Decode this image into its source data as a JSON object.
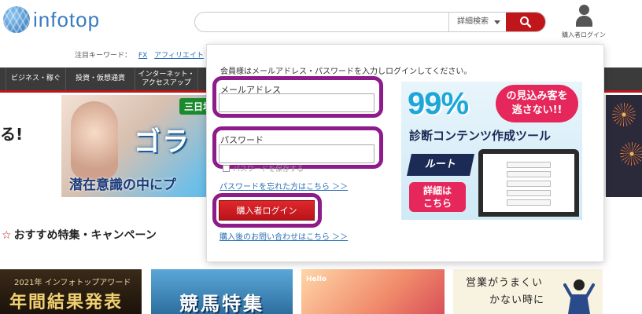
{
  "header": {
    "logo_text": "infotop",
    "search_placeholder": "",
    "search_detail_label": "詳細検索",
    "user_label": "購入者ログイン"
  },
  "keywords": {
    "label": "注目キーワード：",
    "items": [
      "FX",
      "アフィリエイト"
    ]
  },
  "nav": {
    "items": [
      "ビジネス・稼ぐ",
      "投資・仮想通貨",
      "インターネット・\nアクセスアップ"
    ]
  },
  "banner": {
    "left_text": "る!",
    "tag": "三日坊",
    "big_text": "ゴラ",
    "sub_text": "潜在意識の中にプ"
  },
  "recommended": {
    "title": "おすすめ特集・キャンペーン"
  },
  "thumbs": {
    "t1_top": "2021年 インフォトップアワード",
    "t1_main": "年間結果発表",
    "t2_main": "競馬特集",
    "t3_text": "Hello",
    "t4_line1": "営業がうまくい",
    "t4_line2": "かない時に"
  },
  "modal": {
    "intro": "会員様はメールアドレス・パスワードを入力しログインしてください。",
    "email_label": "メールアドレス",
    "email_value": "",
    "password_label": "パスワード",
    "password_value": "",
    "remember_label": "パスワードを保存する",
    "forgot_link": "パスワードを忘れた方はこちら ＞＞",
    "login_button": "購入者ログイン",
    "contact_link": "購入後のお問い合わせはこちら ＞＞"
  },
  "ad": {
    "pct": "99%",
    "no_miss": "の見込み客を\n逃さない!!",
    "line2": "診断コンテンツ作成ツール",
    "logo": "ルート",
    "button": "詳細は\nこちら"
  },
  "colors": {
    "accent_red": "#c0161a",
    "highlight_purple": "#8d1b8a",
    "link_blue": "#2a6fb5"
  }
}
